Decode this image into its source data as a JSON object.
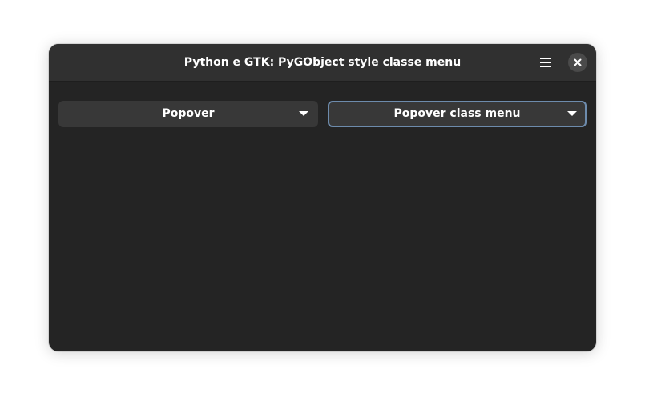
{
  "window": {
    "title": "Python e GTK: PyGObject style classe menu"
  },
  "headerbar": {
    "menu_icon": "hamburger-menu-icon",
    "close_icon": "close-icon"
  },
  "content": {
    "buttons": [
      {
        "label": "Popover",
        "icon": "pan-down-icon"
      },
      {
        "label": "Popover class menu",
        "icon": "pan-down-icon",
        "focused": true
      }
    ]
  },
  "colors": {
    "window_bg": "#242424",
    "headerbar_bg": "#303030",
    "button_bg": "#383838",
    "focus_ring": "#6d8bac",
    "text": "#ffffff"
  }
}
